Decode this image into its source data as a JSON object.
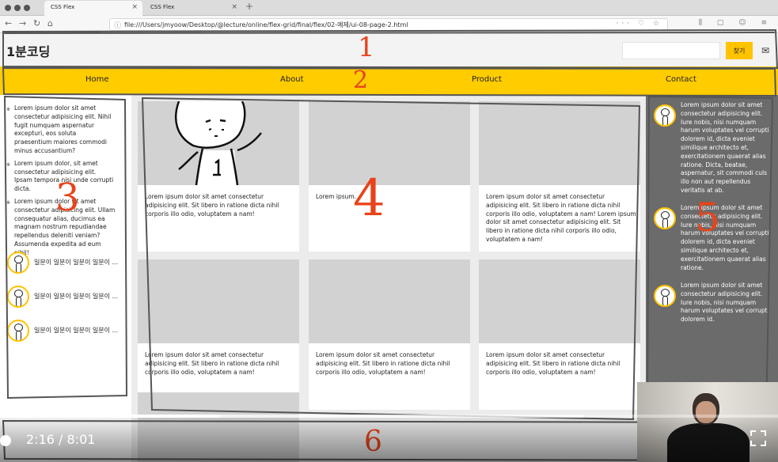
{
  "browser": {
    "tabs": [
      {
        "label": "CSS Flex",
        "active": true
      },
      {
        "label": "CSS Flex",
        "active": false
      }
    ],
    "url": "file:///Users/jmyoow/Desktop/@lecture/online/flex-grid/final/flex/02-예제/ui-08-page-2.html"
  },
  "header": {
    "logo": "1분코딩",
    "search_button": "찾기",
    "mail_icon": "mail-icon"
  },
  "nav": {
    "items": [
      "Home",
      "About",
      "Product",
      "Contact"
    ]
  },
  "left_sidebar": {
    "list": [
      "Lorem ipsum dolor sit amet consectetur adipisicing elit. Nihil fugit numquam aspernatur excepturi, eos soluta praesentium maiores commodi minus accusantium?",
      "Lorem ipsum dolor, sit amet consectetur adipisicing elit. Ipsam tempora nisi unde corrupti dicta.",
      "Lorem ipsum dolor sit amet consectetur adipisicing elit. Ullam consequatur alias, ducimus ea magnam nostrum repudiandae repellendus deleniti veniam? Assumenda expedita ad eum nihil!"
    ],
    "profiles": [
      "일분이 일분이 일분이 일분이 ...",
      "일분이 일분이 일분이 일분이 ...",
      "일분이 일분이 일분이 일분이 ..."
    ]
  },
  "cards": [
    {
      "text": "Lorem ipsum dolor sit amet consectetur adipisicing elit. Sit libero in ratione dicta nihil corporis illo odio, voluptatem a nam!"
    },
    {
      "text": "Lorem ipsum."
    },
    {
      "text": "Lorem ipsum dolor sit amet consectetur adipisicing elit. Sit libero in ratione dicta nihil corporis illo odio, voluptatem a nam! Lorem ipsum dolor sit amet consectetur adipisicing elit. Sit libero in ratione dicta nihil corporis illo odio, voluptatem a nam!"
    },
    {
      "text": "Lorem ipsum dolor sit amet consectetur adipisicing elit. Sit libero in ratione dicta nihil corporis illo odio, voluptatem a nam!"
    },
    {
      "text": "Lorem ipsum dolor sit amet consectetur adipisicing elit. Sit libero in ratione dicta nihil corporis illo odio, voluptatem a nam!"
    },
    {
      "text": "Lorem ipsum dolor sit amet consectetur adipisicing elit. Sit libero in ratione dicta nihil corporis illo odio, voluptatem a nam!"
    }
  ],
  "right_sidebar": [
    "Lorem ipsum dolor sit amet consectetur adipisicing elit. Iure nobis, nisi numquam harum voluptates vel corrupti dolorem id, dicta eveniet similique architecto et, exercitationem quaerat alias ratione. Dicta, beatae, aspernatur, sit commodi culs illo non aut repellendus veritatis at ab.",
    "Lorem ipsum dolor sit amet consectetur adipisicing elit. Iure nobis, nisi numquam harum voluptates vel corrupti dolorem id, dicta eveniet similique architecto et, exercitationem quaerat alias ratione.",
    "Lorem ipsum dolor sit amet consectetur adipisicing elit. Iure nobis, nisi numquam harum voluptates vel corrupti dolorem id."
  ],
  "video": {
    "time": "2:16 / 8:01",
    "played_fraction": 0.283,
    "buffered_fraction": 0.75
  },
  "annotations": [
    "1",
    "2",
    "3",
    "4",
    "5",
    "6"
  ],
  "colors": {
    "accent": "#ffcc00",
    "annotation": "#e8431a",
    "right_sidebar_bg": "#6b6b6b"
  }
}
